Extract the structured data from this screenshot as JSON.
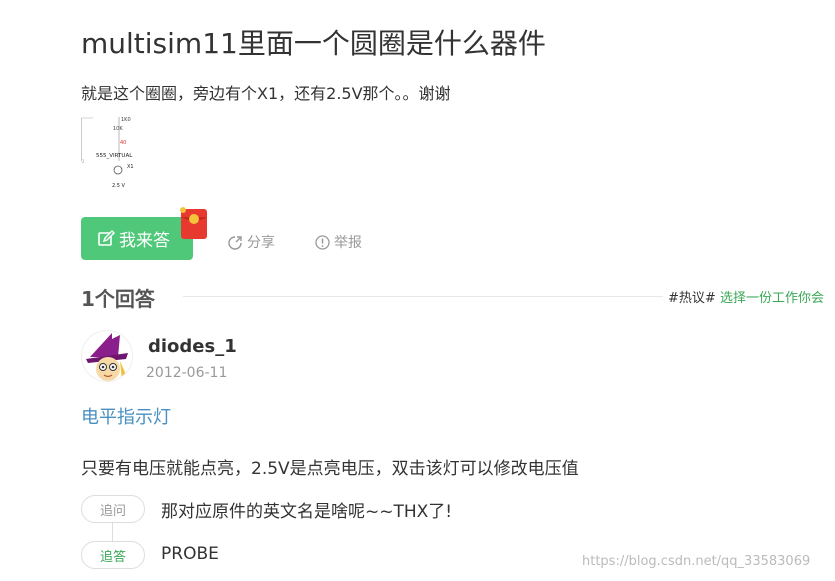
{
  "question": {
    "title": "multisim11里面一个圆圈是什么器件",
    "description": "就是这个圈圈，旁边有个X1，还有2.5V那个。。谢谢",
    "image": {
      "labels": [
        "1K0",
        "10K",
        "40",
        "555_VIRTUAL",
        "X1",
        "2.5 V"
      ]
    }
  },
  "actions": {
    "answer_button": "我来答",
    "share": "分享",
    "report": "举报"
  },
  "answers_section": {
    "count_label": "1个回答",
    "hot_tag": "#热议#",
    "hot_link": "选择一份工作你会"
  },
  "answer": {
    "username": "diodes_1",
    "date": "2012-06-11",
    "best_answer": "电平指示灯",
    "text": "只要有电压就能点亮，2.5V是点亮电压，双击该灯可以修改电压值"
  },
  "followups": {
    "question_tag": "追问",
    "question_text": "那对应原件的英文名是啥呢~~THX了!",
    "answer_tag": "追答",
    "answer_text": "PROBE"
  },
  "watermark": "https://blog.csdn.net/qq_33583069",
  "colors": {
    "accent_green": "#4fc87a",
    "link_blue": "#4a8fc1",
    "hot_green": "#3aa757"
  }
}
